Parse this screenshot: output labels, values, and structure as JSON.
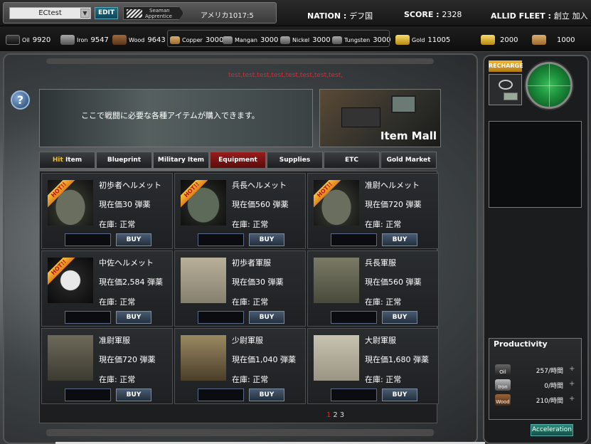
{
  "top": {
    "username": "ECtest",
    "edit_label": "EDIT",
    "rank_line1": "Seaman",
    "rank_line2": "Apprentice",
    "nation_name": "アメリカ1017:5",
    "nation_label": "NATION :",
    "nation_value": "デフ国",
    "score_label": "SCORE :",
    "score_value": "2328",
    "fleet_label": "ALLID FLEET :",
    "fleet_create": "創立",
    "fleet_join": "加入"
  },
  "resources": {
    "oil": {
      "label": "Oil",
      "value": "9920"
    },
    "iron": {
      "label": "Iron",
      "value": "9547"
    },
    "wood": {
      "label": "Wood",
      "value": "9643"
    },
    "copper": {
      "label": "Copper",
      "value": "3000"
    },
    "mangan": {
      "label": "Mangan",
      "value": "3000"
    },
    "nickel": {
      "label": "Nickel",
      "value": "3000"
    },
    "tungsten": {
      "label": "Tungsten",
      "value": "3000"
    },
    "gold": {
      "label": "Gold",
      "value": "11005"
    },
    "ticket1": {
      "value": "2000"
    },
    "ticket2": {
      "value": "1000"
    }
  },
  "shop": {
    "marquee": "test,test,test,test,test,test,test,test,",
    "help_icon": "?",
    "banner_text": "ここで戦闘に必要な各種アイテムが購入できます。",
    "mall_title": "Item Mall",
    "tabs": [
      {
        "pre": "Hit",
        "label": " Item"
      },
      {
        "pre": "",
        "label": "Blueprint"
      },
      {
        "pre": "",
        "label": "Military Item"
      },
      {
        "pre": "",
        "label": "Equipment"
      },
      {
        "pre": "",
        "label": "Supplies"
      },
      {
        "pre": "",
        "label": "ETC"
      },
      {
        "pre": "",
        "label": "Gold Market"
      }
    ],
    "active_tab": 3,
    "items": [
      {
        "name": "初歩者ヘルメット",
        "price": "現在価30 弾薬",
        "stock": "在庫: 正常",
        "hot": true,
        "buy": "BUY"
      },
      {
        "name": "兵長ヘルメット",
        "price": "現在価560 弾薬",
        "stock": "在庫: 正常",
        "hot": true,
        "buy": "BUY"
      },
      {
        "name": "准尉ヘルメット",
        "price": "現在価720 弾薬",
        "stock": "在庫: 正常",
        "hot": true,
        "buy": "BUY"
      },
      {
        "name": "中佐ヘルメット",
        "price": "現在価2,584 弾薬",
        "stock": "在庫: 正常",
        "hot": true,
        "buy": "BUY"
      },
      {
        "name": "初歩者軍服",
        "price": "現在価30 弾薬",
        "stock": "在庫: 正常",
        "hot": false,
        "buy": "BUY"
      },
      {
        "name": "兵長軍服",
        "price": "現在価560 弾薬",
        "stock": "在庫: 正常",
        "hot": false,
        "buy": "BUY"
      },
      {
        "name": "准尉軍服",
        "price": "現在価720 弾薬",
        "stock": "在庫: 正常",
        "hot": false,
        "buy": "BUY"
      },
      {
        "name": "少尉軍服",
        "price": "現在価1,040 弾薬",
        "stock": "在庫: 正常",
        "hot": false,
        "buy": "BUY"
      },
      {
        "name": "大尉軍服",
        "price": "現在価1,680 弾薬",
        "stock": "在庫: 正常",
        "hot": false,
        "buy": "BUY"
      }
    ],
    "hot_label": "HOT!!",
    "pages": [
      "1",
      "2",
      "3"
    ],
    "current_page": "1"
  },
  "side": {
    "recharge": "RECHARGE",
    "productivity_title": "Productivity",
    "rows": [
      {
        "label": "Oil",
        "value": "257/時間"
      },
      {
        "label": "Iron",
        "value": "0/時間"
      },
      {
        "label": "Wood",
        "value": "210/時間"
      }
    ],
    "plus": "+",
    "acceleration": "Acceleration"
  }
}
